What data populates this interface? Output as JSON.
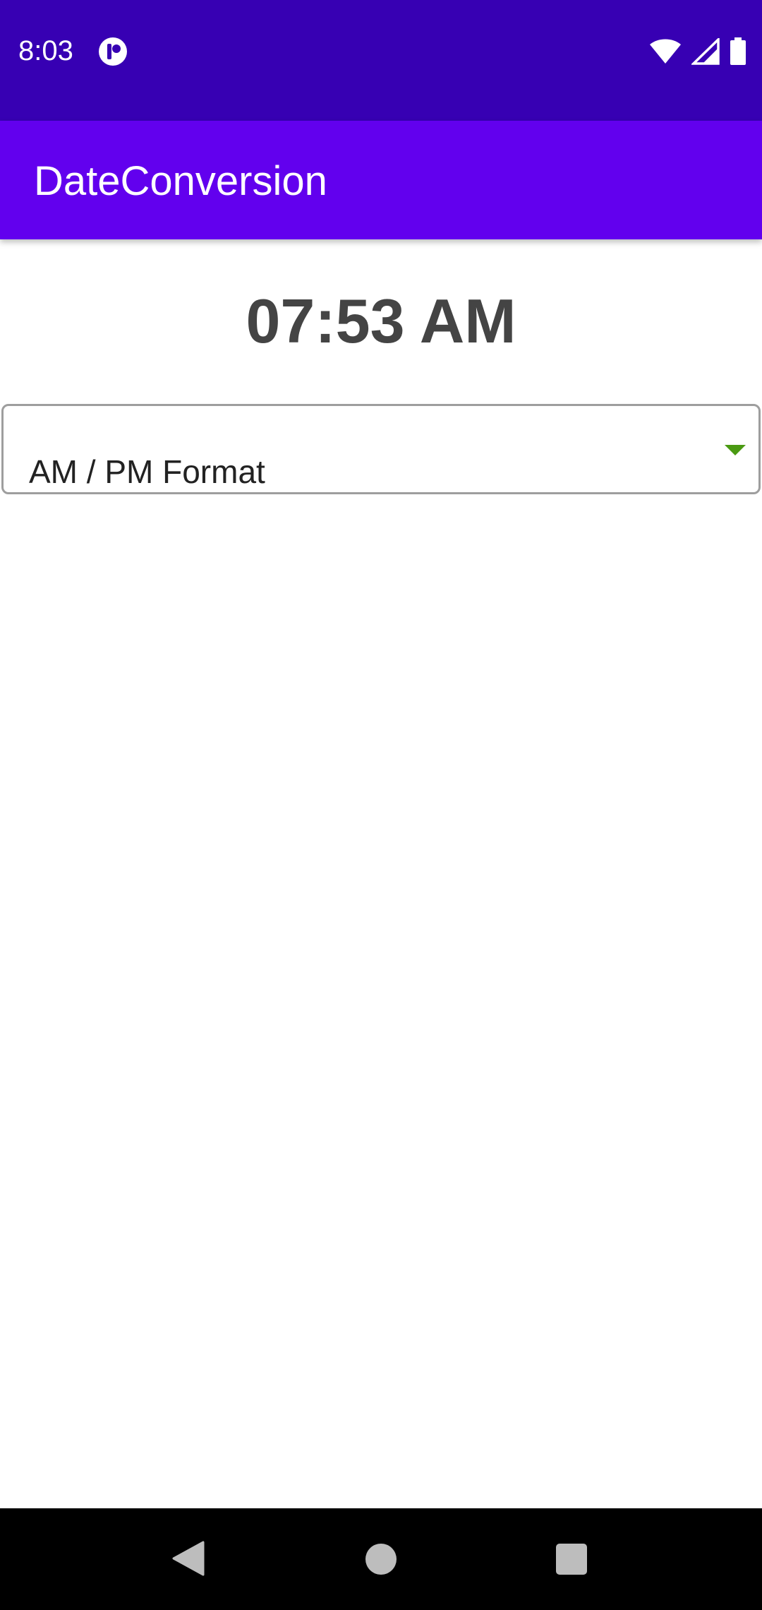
{
  "status_bar": {
    "time": "8:03",
    "icons": [
      "app-notification-icon",
      "wifi-icon",
      "signal-icon",
      "battery-icon"
    ],
    "background": "#3700B3"
  },
  "app_bar": {
    "title": "DateConversion",
    "background": "#6200EE"
  },
  "main": {
    "time_value": "07:53 AM",
    "format_spinner": {
      "selected": "AM / PM Format",
      "arrow_color": "#4a9a12"
    }
  },
  "nav_bar": {
    "buttons": [
      "back-icon",
      "home-icon",
      "recents-icon"
    ]
  }
}
